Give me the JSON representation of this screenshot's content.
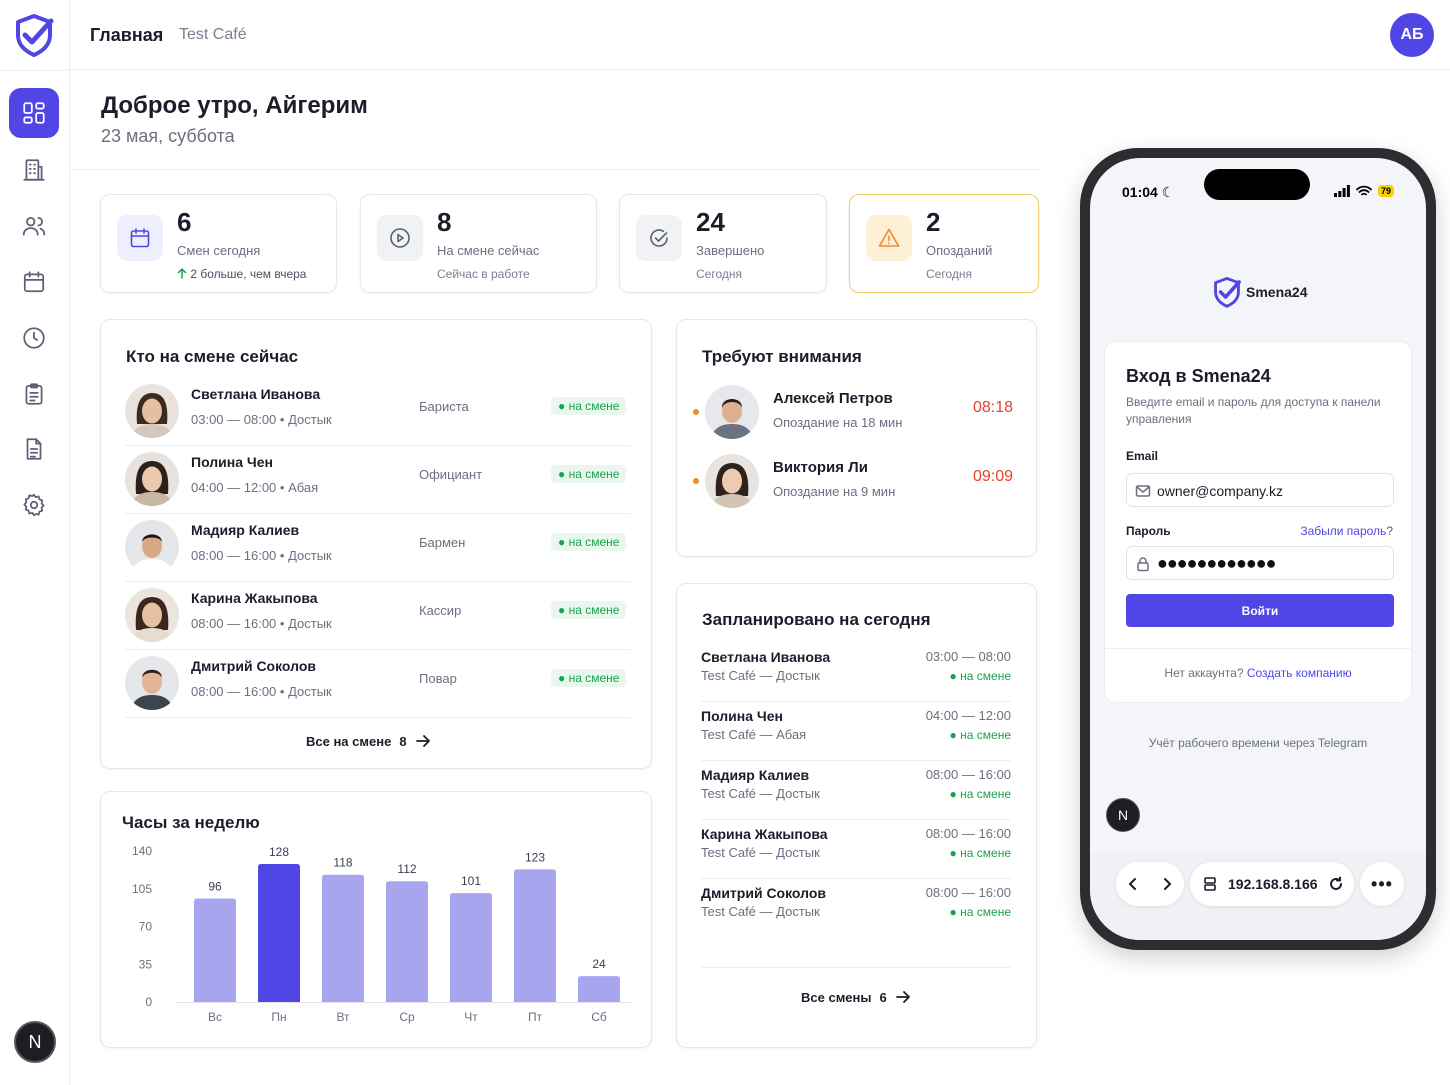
{
  "header": {
    "home": "Главная",
    "cafe": "Test Café",
    "avatar_initials": "АБ"
  },
  "sidebar": {
    "items": [
      {
        "name": "dashboard-icon",
        "active": true
      },
      {
        "name": "building-icon"
      },
      {
        "name": "users-icon"
      },
      {
        "name": "calendar-icon"
      },
      {
        "name": "clock-icon"
      },
      {
        "name": "clipboard-icon"
      },
      {
        "name": "document-icon"
      },
      {
        "name": "gear-icon"
      }
    ],
    "user_initial": "N"
  },
  "greeting": {
    "title": "Доброе утро, Айгерим",
    "date": "23 мая, суббота"
  },
  "stats": [
    {
      "icon": "calendar-icon",
      "value": "6",
      "label": "Смен сегодня",
      "sub": "2 больше, чем вчера",
      "trend": "up"
    },
    {
      "icon": "play-icon",
      "value": "8",
      "label": "На смене сейчас",
      "sub": "Сейчас в работе"
    },
    {
      "icon": "check-circle-icon",
      "value": "24",
      "label": "Завершено",
      "sub": "Сегодня"
    },
    {
      "icon": "warning-icon",
      "value": "2",
      "label": "Опозданий",
      "sub": "Сегодня",
      "accent": "#f08a24"
    }
  ],
  "on_shift": {
    "title": "Кто на смене сейчас",
    "rows": [
      {
        "name": "Светлана Иванова",
        "time": "03:00 — 08:00",
        "location": "Достык",
        "role": "Бариста",
        "status": "на смене"
      },
      {
        "name": "Полина Чен",
        "time": "04:00 — 12:00",
        "location": "Абая",
        "role": "Официант",
        "status": "на смене"
      },
      {
        "name": "Мадияр Калиев",
        "time": "08:00 — 16:00",
        "location": "Достык",
        "role": "Бармен",
        "status": "на смене"
      },
      {
        "name": "Карина Жакыпова",
        "time": "08:00 — 16:00",
        "location": "Достык",
        "role": "Кассир",
        "status": "на смене"
      },
      {
        "name": "Дмитрий Соколов",
        "time": "08:00 — 16:00",
        "location": "Достык",
        "role": "Повар",
        "status": "на смене"
      }
    ],
    "all_label": "Все на смене",
    "all_count": "8"
  },
  "attention": {
    "title": "Требуют внимания",
    "rows": [
      {
        "name": "Алексей Петров",
        "note": "Опоздание на 18 мин",
        "time": "08:18"
      },
      {
        "name": "Виктория Ли",
        "note": "Опоздание на 9 мин",
        "time": "09:09"
      }
    ]
  },
  "planned": {
    "title": "Запланировано на сегодня",
    "rows": [
      {
        "name": "Светлана Иванова",
        "location": "Test Café — Достык",
        "time": "03:00 — 08:00",
        "status": "на смене"
      },
      {
        "name": "Полина Чен",
        "location": "Test Café — Абая",
        "time": "04:00 — 12:00",
        "status": "на смене"
      },
      {
        "name": "Мадияр Калиев",
        "location": "Test Café — Достык",
        "time": "08:00 — 16:00",
        "status": "на смене"
      },
      {
        "name": "Карина Жакыпова",
        "location": "Test Café — Достык",
        "time": "08:00 — 16:00",
        "status": "на смене"
      },
      {
        "name": "Дмитрий Соколов",
        "location": "Test Café — Достык",
        "time": "08:00 — 16:00",
        "status": "на смене"
      }
    ],
    "all_label": "Все смены",
    "all_count": "6"
  },
  "colors": {
    "accent": "#4f46e5",
    "bar": "#a8a5ef",
    "bar_highlight": "#4f46e5",
    "success": "#17a34a",
    "danger": "#e5412c",
    "warning": "#f08a24"
  },
  "chart_data": {
    "type": "bar",
    "title": "Часы за неделю",
    "categories": [
      "Вс",
      "Пн",
      "Вт",
      "Ср",
      "Чт",
      "Пт",
      "Сб"
    ],
    "values": [
      96,
      128,
      118,
      112,
      101,
      123,
      24
    ],
    "highlight": "Пн",
    "yticks": [
      0,
      35,
      70,
      105,
      140
    ],
    "ylim": [
      0,
      140
    ],
    "grid": false
  },
  "phone": {
    "status_time": "01:04",
    "battery": "79",
    "brand": "Smena24",
    "login_title": "Вход в Smena24",
    "login_subtitle": "Введите email и пароль для доступа к панели управления",
    "email_label": "Email",
    "email_value": "owner@company.kz",
    "password_label": "Пароль",
    "forgot": "Забыли пароль?",
    "password_mask": "●●●●●●●●●●●●",
    "submit": "Войти",
    "no_account": "Нет аккаунта?",
    "create": "Создать компанию",
    "tagline": "Учёт рабочего времени через Telegram",
    "user_initial": "N",
    "url": "192.168.8.166"
  }
}
